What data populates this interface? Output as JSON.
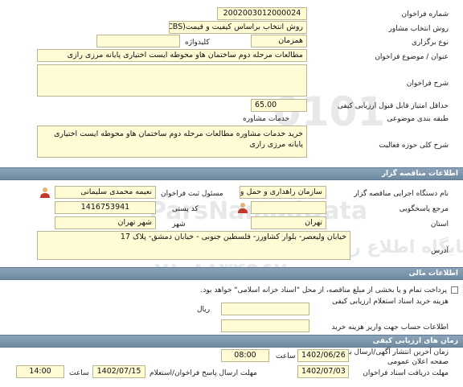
{
  "general": {
    "tender_number_label": "شماره فراخوان",
    "tender_number": "2002003012000024",
    "selection_method_label": "روش انتخاب مشاور",
    "selection_method": "روش انتخاب براساس کیفیت و قیمت(QCBS)",
    "holding_type_label": "نوع برگزاری",
    "holding_type": "همزمان",
    "keyword_label": "کلیدواژه",
    "keyword": "",
    "subject_label": "عنوان / موضوع فراخوان",
    "subject": "مطالعات مرحله دوم ساختمان هاو محوطه ایست اختیاری پایانه مرزی رازی",
    "description_label": "شرح فراخوان",
    "description": "",
    "min_score_label": "حداقل امتیاز قابل قبول ارزیابی کیفی",
    "min_score": "65.00",
    "topic_class_label": "طبقه بندی موضوعی",
    "topic_class": "خدمات مشاوره",
    "activity_scope_label": "شرح کلی حوزه فعالیت",
    "activity_scope": "خرید خدمات مشاوره مطالعات مرحله دوم ساختمان هاو محوطه ایست اختیاری پایانه مرزی رازی"
  },
  "organizer": {
    "section_title": "اطلاعات مناقصه گزار",
    "org_label": "نام دستگاه اجرایی مناقصه گزار",
    "org_name": "سازمان راهداری و حمل و ن",
    "registrar_label": "مسئول ثبت فراخوان",
    "registrar": "نعیمه محمدی سلیمانی",
    "reference_label": "مرجع پاسخگویی",
    "reference": "",
    "postal_label": "کد پستی",
    "postal_code": "1416753941",
    "province_label": "استان",
    "province": "تهران",
    "city_label": "شهر",
    "city": "شهر تهران",
    "address_label": "آدرس",
    "address": "خیابان ولیعصر- بلوار کشاورز- فلسطین جنوبی - خیابان دمشق- پلاک 17"
  },
  "finance": {
    "section_title": "اطلاعات مالی",
    "treasury_note": "پرداخت تمام و یا بخشی از مبلغ مناقصه، از محل \"اسناد خزانه اسلامی\" خواهد بود.",
    "doc_cost_label": "هزینه خرید اسناد استعلام ارزیابی کیفی",
    "doc_cost": "",
    "currency": "ریال",
    "account_label": "اطلاعات حساب جهت واریز هزینه خرید",
    "account": ""
  },
  "schedule": {
    "section_title": "زمان های ارزیابی کیفی",
    "publish_label": "زمان آخرین انتشار آگهی/ارسال به صفحه اعلان عمومی",
    "publish_date": "1402/06/26",
    "time_label": "ساعت",
    "publish_time": "08:00",
    "doc_receive_label": "مهلت دریافت اسناد فراخوان",
    "doc_receive_date": "1402/07/03",
    "reply_label": "مهلت ارسال پاسخ فراخوان/استعلام",
    "reply_date": "1402/07/15",
    "reply_time": "14:00",
    "left_time": "14:00"
  },
  "watermark": {
    "line1": "ParsNamadData",
    "line2": "پایگاه اطلاع رسانی مناقصه و مزایده",
    "line3": "۰۲۱-۸۸۳۴۹۶۷۰",
    "digits": "0101"
  },
  "colors": {
    "field_bg": "#fffbd5",
    "bar_bg": "#7a93a9"
  }
}
